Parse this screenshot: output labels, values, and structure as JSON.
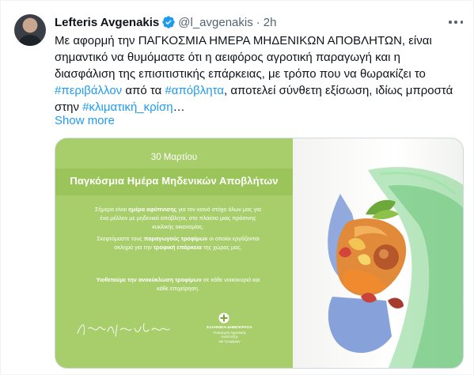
{
  "author": {
    "name": "Lefteris Avgenakis",
    "handle": "@l_avgenakis",
    "separator": "·",
    "time": "2h"
  },
  "tweet": {
    "line1": "Με αφορμή την ΠΑΓΚΟΣΜΙΑ ΗΜΕΡΑ ΜΗΔΕΝΙΚΩΝ ΑΠΟΒΛΗΤΩΝ, είναι",
    "line2": "σημαντικό να θυμόμαστε ότι η αειφόρος αγροτική παραγωγή και η",
    "line3": "διασφάλιση της επισιτιστικής επάρκειας, με τρόπο που να θωρακίζει το",
    "line4_tag1": "#περιβάλλον",
    "line4_mid": " από τα ",
    "line4_tag2": "#απόβλητα",
    "line4_end": ", αποτελεί σύνθετη εξίσωση, ιδίως μπροστά",
    "line5_start": "στην ",
    "line5_tag": "#κλιματική_κρίση",
    "line5_end": "…",
    "show_more": "Show more"
  },
  "poster": {
    "date": "30 Μαρτίου",
    "title": "Παγκόσμια Ημέρα Μηδενικών Αποβλήτων",
    "p1_a": "Σήμερα είναι ",
    "p1_b": "ημέρα αφύπνισης",
    "p1_c": " για τον κοινό στόχο όλων μας για",
    "p1_d": "ένα μέλλον με μηδενικά απόβλητα, στο πλαίσιο μιας πράσινης",
    "p1_e": "κυκλικής οικονομίας.",
    "p2_a": "Σκεφτόμαστε τους ",
    "p2_b": "παραγωγούς τροφίμων",
    "p2_c": " οι οποίοι εργάζονται",
    "p2_d": "σκληρά για την ",
    "p2_e": "τροφική επάρκεια",
    "p2_f": " της χώρας μας.",
    "p3_a": "Υιοθετούμε την ανακύκλωση τροφίμων",
    "p3_b": " σε κάθε νοικοκυριό και",
    "p3_c": "κάθε επιχείρηση.",
    "signature_text": "Λευτέρης Αυγενάκης",
    "ministry_l1": "ΕΛΛΗΝΙΚΗ ΔΗΜΟΚΡΑΤΙΑ",
    "ministry_l2": "Υπουργείο Αγροτικής Ανάπτυξης",
    "ministry_l3": "και Τροφίμων"
  },
  "colors": {
    "link": "#1d9bf0",
    "poster_green": "#a8ce6b",
    "verified": "#1d9bf0"
  },
  "icons": [
    "verified-badge-icon",
    "more-options-icon",
    "greek-emblem-icon"
  ]
}
